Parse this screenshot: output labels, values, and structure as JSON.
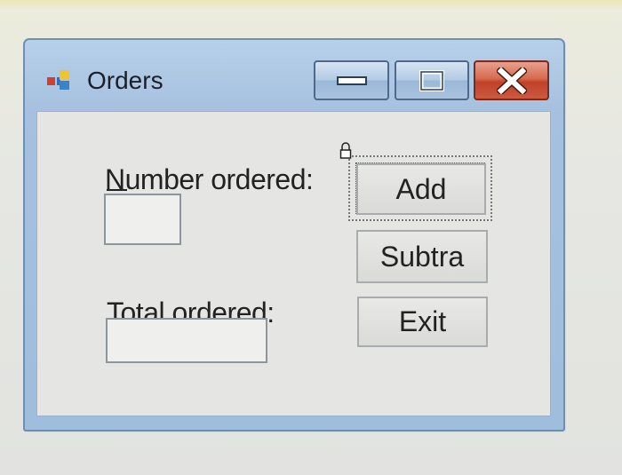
{
  "window": {
    "title": "Orders",
    "icon": "app-form-icon",
    "controls": {
      "minimize": "minimize-icon",
      "maximize": "maximize-icon",
      "close": "close-icon"
    }
  },
  "form": {
    "number_ordered_label": "Number ordered:",
    "number_ordered_value": "",
    "total_ordered_label": "Total ordered:",
    "total_ordered_value": "",
    "add_button": "Add",
    "subtract_button": "Subtra",
    "exit_button": "Exit",
    "designer_lock": "lock-icon"
  },
  "colors": {
    "title_bar": "#a6c1df",
    "close_button": "#c1412a",
    "client_area": "#e5e6e4"
  }
}
